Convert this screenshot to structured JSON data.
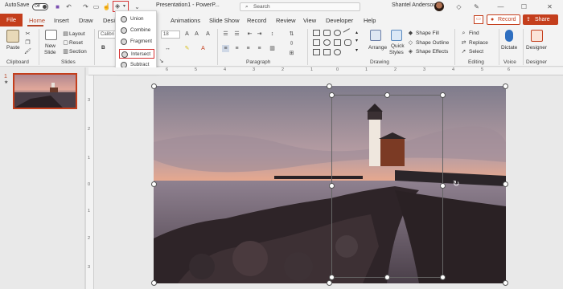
{
  "titlebar": {
    "autosave_label": "AutoSave",
    "autosave_state": "Off",
    "doc_title": "Presentation1 - PowerP...",
    "search_placeholder": "Search",
    "user_name": "Shantel Anderson"
  },
  "tabs": {
    "file": "File",
    "home": "Home",
    "insert": "Insert",
    "draw": "Draw",
    "design": "Desi",
    "animations": "Animations",
    "slideshow": "Slide Show",
    "record": "Record",
    "review": "Review",
    "view": "View",
    "developer": "Developer",
    "help": "Help"
  },
  "actions": {
    "record": "Record",
    "share": "Share"
  },
  "ribbon": {
    "clipboard": {
      "paste": "Paste",
      "label": "Clipboard"
    },
    "slides": {
      "new_slide": "New",
      "new_slide2": "Slide",
      "layout": "Layout",
      "reset": "Reset",
      "section": "Section",
      "label": "Slides"
    },
    "font": {
      "name": "Calibri",
      "size": "18"
    },
    "paragraph": {
      "label": "Paragraph"
    },
    "drawing": {
      "arrange": "Arrange",
      "quick_styles": "Quick",
      "quick_styles2": "Styles",
      "shape_fill": "Shape Fill",
      "shape_outline": "Shape Outline",
      "shape_effects": "Shape Effects",
      "label": "Drawing"
    },
    "editing": {
      "find": "Find",
      "replace": "Replace",
      "select": "Select",
      "label": "Editing"
    },
    "voice": {
      "dictate": "Dictate",
      "label": "Voice"
    },
    "designer": {
      "designer": "Designer",
      "label": "Designer"
    }
  },
  "merge_menu": {
    "items": [
      "Union",
      "Combine",
      "Fragment",
      "Intersect",
      "Subtract"
    ],
    "highlighted": "Intersect"
  },
  "thumbnails": {
    "slide_number": "1",
    "star": "★"
  },
  "ruler": {
    "top": [
      "6",
      "5",
      "4",
      "3",
      "2",
      "1",
      "0",
      "1",
      "2",
      "3",
      "4",
      "5",
      "6"
    ],
    "left": [
      "3",
      "2",
      "1",
      "0",
      "1",
      "2",
      "3"
    ]
  },
  "colors": {
    "accent": "#c43e1c",
    "highlight": "#d63333"
  }
}
